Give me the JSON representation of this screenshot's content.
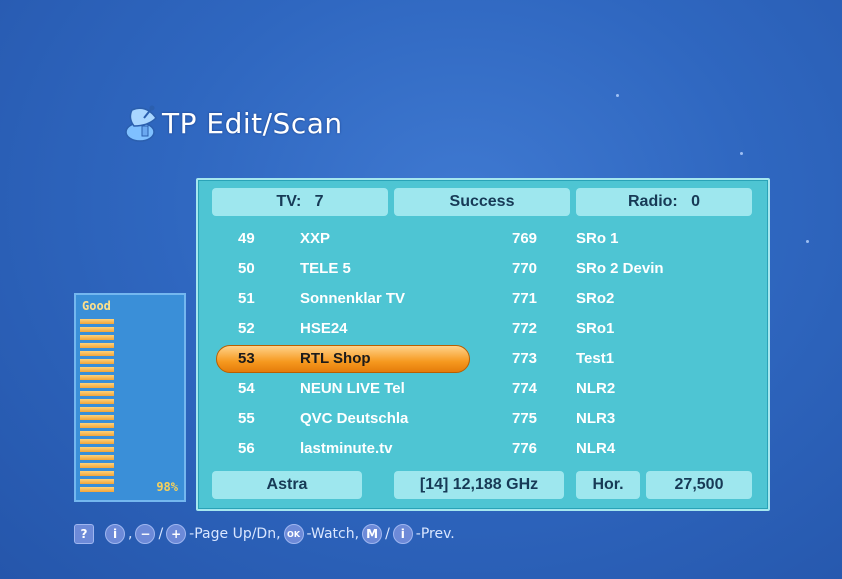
{
  "screen": {
    "title": "TP Edit/Scan"
  },
  "header": {
    "tv_label": "TV:",
    "tv_count": "7",
    "status": "Success",
    "radio_label": "Radio:",
    "radio_count": "0"
  },
  "tv_list": [
    {
      "num": "49",
      "name": "XXP"
    },
    {
      "num": "50",
      "name": "TELE 5"
    },
    {
      "num": "51",
      "name": "Sonnenklar TV"
    },
    {
      "num": "52",
      "name": "HSE24"
    },
    {
      "num": "53",
      "name": "RTL Shop"
    },
    {
      "num": "54",
      "name": "NEUN LIVE Tel"
    },
    {
      "num": "55",
      "name": "QVC Deutschla"
    },
    {
      "num": "56",
      "name": "lastminute.tv"
    }
  ],
  "radio_list": [
    {
      "num": "769",
      "name": "SRo 1"
    },
    {
      "num": "770",
      "name": "SRo 2 Devin"
    },
    {
      "num": "771",
      "name": "SRo2"
    },
    {
      "num": "772",
      "name": "SRo1"
    },
    {
      "num": "773",
      "name": "Test1"
    },
    {
      "num": "774",
      "name": "NLR2"
    },
    {
      "num": "775",
      "name": "NLR3"
    },
    {
      "num": "776",
      "name": "NLR4"
    }
  ],
  "selected_index": 4,
  "footer": {
    "satellite": "Astra",
    "transponder": "[14] 12,188 GHz",
    "polarization": "Hor.",
    "symbol_rate": "27,500"
  },
  "signal": {
    "label": "Good",
    "percent_text": "98%",
    "level": 0.98
  },
  "help_bar": {
    "help_key": "?",
    "info_key": "i",
    "minus_key": "−",
    "plus_key": "+",
    "page_text": "-Page Up/Dn,",
    "ok_key": "OK",
    "watch_text": "-Watch,",
    "m_key": "M",
    "i2_key": "i",
    "prev_text": "-Prev."
  },
  "colors": {
    "background": "#2f67c0",
    "panel": "#4ec5d3",
    "header_cell": "#9ee7ee",
    "highlight": "#f6991f",
    "signal_bar": "#f2a53a"
  }
}
